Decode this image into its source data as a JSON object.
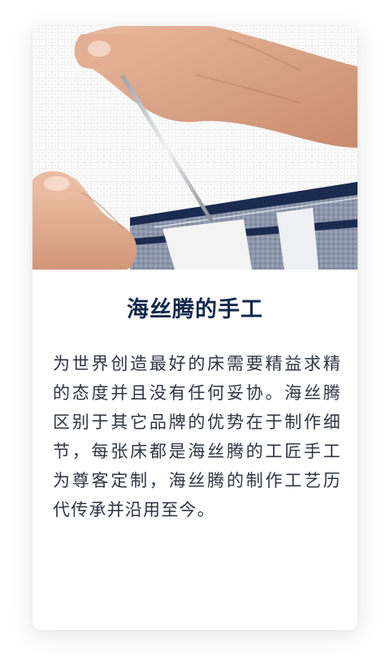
{
  "card": {
    "title": "海丝腾的手工",
    "description": "为世界创造最好的床需要精益求精的态度并且没有任何妥协。海丝腾区别于其它品牌的优势在于制作细节，每张床都是海丝腾的工匠手工为尊客定制，海丝腾的制作工艺历代传承并沿用至今。",
    "image_subject": "hands stitching a mattress with a needle",
    "colors": {
      "title": "#14284b",
      "text": "#2e3542",
      "stripe_navy": "#1b2b4f",
      "fabric": "#ffffff"
    }
  }
}
